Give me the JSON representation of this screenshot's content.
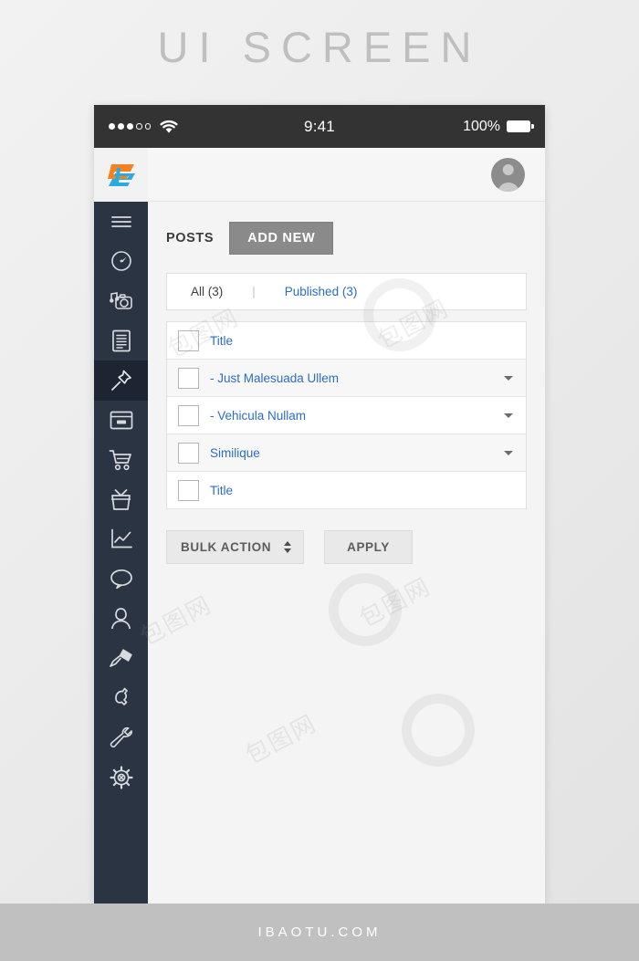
{
  "page": {
    "title": "UI SCREEN",
    "footer_text": "IBAOTU.COM",
    "watermark_text": "包图网"
  },
  "statusbar": {
    "time": "9:41",
    "battery_percent": "100%",
    "signal_dots_filled": 3,
    "signal_dots_empty": 2,
    "wifi_icon": "wifi-icon",
    "battery_icon": "battery-icon"
  },
  "brand": {
    "logo_icon": "brand-logo-icon",
    "color_orange": "#f58220",
    "color_blue": "#29abe2"
  },
  "topbar": {
    "avatar_icon": "avatar-icon"
  },
  "sidebar": {
    "items": [
      {
        "name": "menu-toggle",
        "icon": "hamburger-icon",
        "active": false
      },
      {
        "name": "dashboard",
        "icon": "gauge-icon",
        "active": false
      },
      {
        "name": "media",
        "icon": "camera-music-icon",
        "active": false
      },
      {
        "name": "pages",
        "icon": "document-icon",
        "active": false
      },
      {
        "name": "posts",
        "icon": "pin-icon",
        "active": true
      },
      {
        "name": "appearance",
        "icon": "window-card-icon",
        "active": false
      },
      {
        "name": "shop",
        "icon": "shopping-cart-icon",
        "active": false
      },
      {
        "name": "offers",
        "icon": "gift-box-icon",
        "active": false
      },
      {
        "name": "analytics",
        "icon": "line-chart-icon",
        "active": false
      },
      {
        "name": "comments",
        "icon": "speech-bubble-icon",
        "active": false
      },
      {
        "name": "users",
        "icon": "user-icon",
        "active": false
      },
      {
        "name": "themes",
        "icon": "paintbrush-icon",
        "active": false
      },
      {
        "name": "plugins",
        "icon": "plug-icon",
        "active": false
      },
      {
        "name": "tools",
        "icon": "wrench-icon",
        "active": false
      },
      {
        "name": "settings",
        "icon": "gear-icon",
        "active": false
      }
    ]
  },
  "main": {
    "section_label": "POSTS",
    "add_new_label": "ADD NEW",
    "filters": {
      "all_label": "All (3)",
      "separator": "|",
      "published_label": "Published (3)"
    },
    "list": [
      {
        "label": "Title",
        "has_caret": false,
        "alt": false
      },
      {
        "label": "- Just Malesuada Ullem",
        "has_caret": true,
        "alt": true
      },
      {
        "label": "- Vehicula Nullam",
        "has_caret": true,
        "alt": false
      },
      {
        "label": "Similique",
        "has_caret": true,
        "alt": true
      },
      {
        "label": "Title",
        "has_caret": false,
        "alt": false
      }
    ],
    "bulk_action_label": "BULK ACTION",
    "apply_label": "APPLY"
  }
}
